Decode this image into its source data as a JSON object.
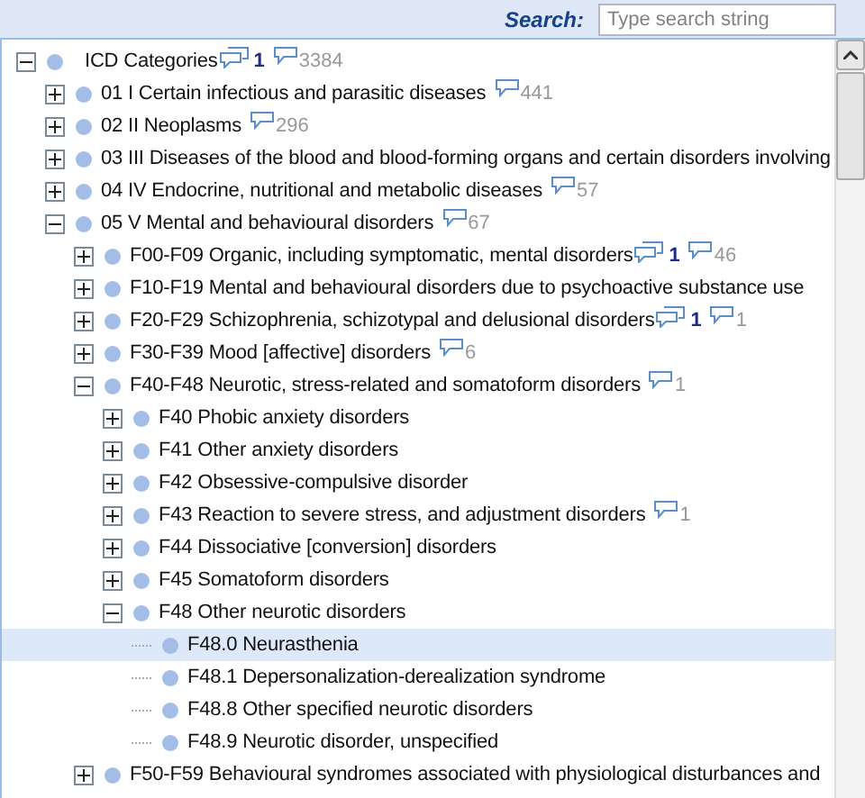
{
  "search": {
    "label": "Search:",
    "placeholder": "Type search string"
  },
  "tree": [
    {
      "label": "ICD Categories",
      "expanded": true,
      "selected": false,
      "notes": "1",
      "comments": "3384",
      "children": [
        {
          "label": "01 I Certain infectious and parasitic diseases",
          "expanded": false,
          "selected": false,
          "comments": "441"
        },
        {
          "label": "02 II Neoplasms",
          "expanded": false,
          "selected": false,
          "comments": "296"
        },
        {
          "label": "03 III Diseases of the blood and blood-forming organs and certain disorders involving",
          "expanded": false,
          "selected": false
        },
        {
          "label": "04 IV Endocrine, nutritional and metabolic diseases",
          "expanded": false,
          "selected": false,
          "comments": "57"
        },
        {
          "label": "05 V Mental and behavioural disorders",
          "expanded": true,
          "selected": false,
          "comments": "67",
          "children": [
            {
              "label": "F00-F09 Organic, including symptomatic, mental disorders",
              "expanded": false,
              "selected": false,
              "notes": "1",
              "comments": "46"
            },
            {
              "label": "F10-F19 Mental and behavioural disorders due to psychoactive substance use",
              "expanded": false,
              "selected": false
            },
            {
              "label": "F20-F29 Schizophrenia, schizotypal and delusional disorders",
              "expanded": false,
              "selected": false,
              "notes": "1",
              "comments": "1"
            },
            {
              "label": "F30-F39 Mood [affective] disorders",
              "expanded": false,
              "selected": false,
              "comments": "6"
            },
            {
              "label": "F40-F48 Neurotic, stress-related and somatoform disorders",
              "expanded": true,
              "selected": false,
              "comments": "1",
              "children": [
                {
                  "label": "F40 Phobic anxiety disorders",
                  "expanded": false,
                  "selected": false
                },
                {
                  "label": "F41 Other anxiety disorders",
                  "expanded": false,
                  "selected": false
                },
                {
                  "label": "F42 Obsessive-compulsive disorder",
                  "expanded": false,
                  "selected": false
                },
                {
                  "label": "F43 Reaction to severe stress, and adjustment disorders",
                  "expanded": false,
                  "selected": false,
                  "comments": "1"
                },
                {
                  "label": "F44 Dissociative [conversion] disorders",
                  "expanded": false,
                  "selected": false
                },
                {
                  "label": "F45 Somatoform disorders",
                  "expanded": false,
                  "selected": false
                },
                {
                  "label": "F48 Other neurotic disorders",
                  "expanded": true,
                  "selected": false,
                  "children": [
                    {
                      "label": "F48.0 Neurasthenia",
                      "selected": true
                    },
                    {
                      "label": "F48.1 Depersonalization-derealization syndrome",
                      "selected": false
                    },
                    {
                      "label": "F48.8 Other specified neurotic disorders",
                      "selected": false
                    },
                    {
                      "label": "F48.9 Neurotic disorder, unspecified",
                      "selected": false
                    }
                  ]
                }
              ]
            },
            {
              "label": "F50-F59 Behavioural syndromes associated with physiological disturbances and",
              "expanded": false,
              "selected": false
            }
          ]
        }
      ]
    }
  ]
}
